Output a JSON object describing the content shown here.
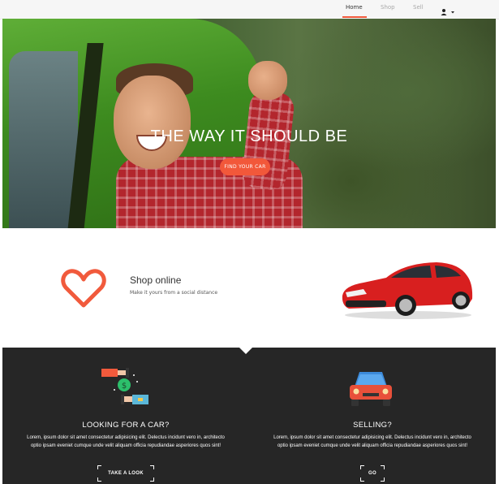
{
  "nav": {
    "items": [
      {
        "label": "Home",
        "active": true
      },
      {
        "label": "Shop",
        "active": false
      },
      {
        "label": "Sell",
        "active": false
      }
    ],
    "user_icon": "user-icon",
    "dropdown_icon": "caret-down-icon"
  },
  "hero": {
    "title": "THE WAY IT SHOULD BE",
    "button_label": "FIND YOUR CAR",
    "image": "man-in-green-car"
  },
  "shop": {
    "icon": "heart-icon",
    "title": "Shop online",
    "subtitle": "Make it yours from a social distance",
    "image": "red-hatchback-car"
  },
  "features": [
    {
      "icon": "money-exchange-icon",
      "title": "LOOKING FOR A CAR?",
      "text": "Lorem, ipsum dolor sit amet consectetur adipisicing elit. Delectus incidunt vero in, architecto optio ipsam eveniet cumque unde velit aliquam officia repudiandae asperiores quos sint!",
      "button_label": "TAKE A LOOK"
    },
    {
      "icon": "car-front-icon",
      "title": "SELLING?",
      "text": "Lorem, ipsum dolor sit amet consectetur adipisicing elit. Delectus incidunt vero in, architecto optio ipsam eveniet cumque unde velit aliquam officia repudiandae asperiores quos sint!",
      "button_label": "GO"
    }
  ],
  "colors": {
    "accent": "#f2583a",
    "dark_section": "#262626",
    "nav_bg": "#f6f6f6"
  }
}
